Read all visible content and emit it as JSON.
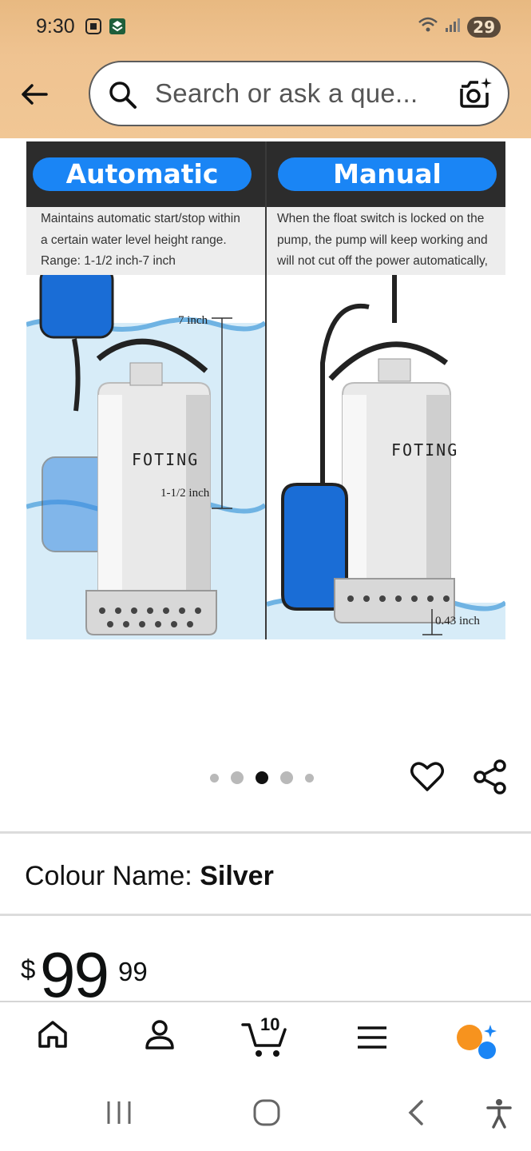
{
  "status_bar": {
    "time": "9:30",
    "battery": "29",
    "icons": [
      "screen-record-icon",
      "app-notification-icon",
      "wifi-icon",
      "signal-icon"
    ]
  },
  "search": {
    "placeholder": "Search or ask a que...",
    "back_icon": "back-arrow-icon",
    "search_icon": "search-icon",
    "camera_icon": "camera-sparkle-icon"
  },
  "product_image": {
    "left_panel": {
      "title": "Automatic",
      "desc_lines": [
        "Maintains automatic start/stop within",
        "a certain water level height range.",
        "Range: 1-1/2 inch-7 inch"
      ],
      "label_top": "7 inch",
      "label_bottom": "1-1/2 inch",
      "brand": "FOTING"
    },
    "right_panel": {
      "title": "Manual",
      "desc_lines": [
        "When the float switch is locked on the",
        "pump, the pump will keep working and",
        "will not cut off the power automatically,"
      ],
      "label_bottom": "0.43 inch",
      "brand": "FOTING"
    },
    "colors": {
      "pill": "#1a85f5",
      "head": "#2c2c2c",
      "water": "#cfe8f7"
    }
  },
  "carousel": {
    "dot_count": 5,
    "active_index": 2
  },
  "actions": {
    "wishlist_icon": "heart-icon",
    "share_icon": "share-icon"
  },
  "colour": {
    "label": "Colour Name: ",
    "value": "Silver"
  },
  "price": {
    "symbol": "$",
    "whole": "99",
    "fraction": "99"
  },
  "bottom_nav": {
    "items": [
      "home-icon",
      "account-icon",
      "cart-icon",
      "menu-icon",
      "rufus-assistant-icon"
    ],
    "cart_count": "10",
    "accent_orange": "#f7931e",
    "accent_blue": "#1a85f5"
  },
  "system_nav": {
    "items": [
      "recent-apps-icon",
      "home-button-icon",
      "back-icon",
      "accessibility-icon"
    ]
  }
}
